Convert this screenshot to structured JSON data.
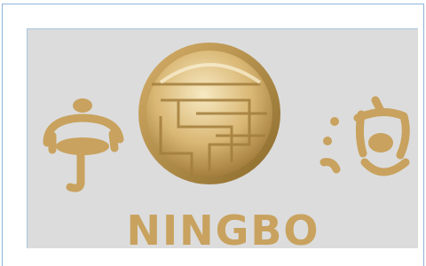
{
  "logo": {
    "brand_text": "NINGBO",
    "left_glyph": "宁",
    "right_glyph": "波",
    "emblem_icon": "golden-disc-emblem",
    "colors": {
      "gold": "#c8a25e",
      "gold_dark": "#8a6a2a",
      "gold_light": "#f3e3b8",
      "panel_bg": "#dcdcdc",
      "frame_border": "#8fb3d9"
    }
  }
}
